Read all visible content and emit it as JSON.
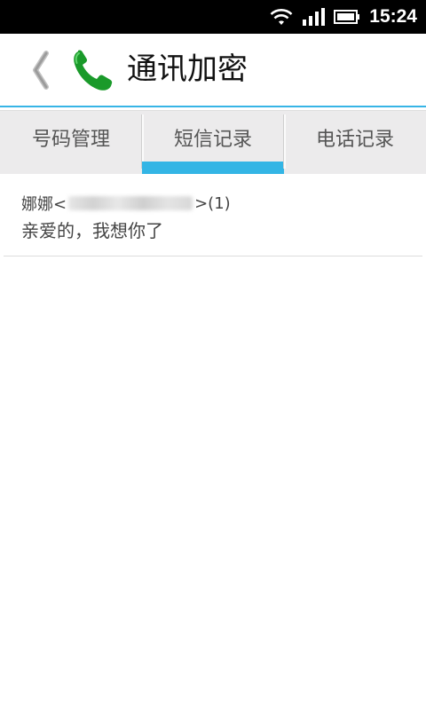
{
  "status_bar": {
    "time": "15:24",
    "icons": [
      "wifi-icon",
      "signal-icon",
      "battery-icon"
    ]
  },
  "action_bar": {
    "title": "通讯加密",
    "back_icon": "chevron-left-icon",
    "app_icon": "phone-icon",
    "accent_color": "#33b5e5"
  },
  "tabs": [
    {
      "label": "号码管理",
      "active": false
    },
    {
      "label": "短信记录",
      "active": true
    },
    {
      "label": "电话记录",
      "active": false
    }
  ],
  "messages": [
    {
      "contact_prefix": "娜娜<",
      "contact_suffix": ">(1)",
      "preview": "亲爱的，我想你了"
    }
  ]
}
